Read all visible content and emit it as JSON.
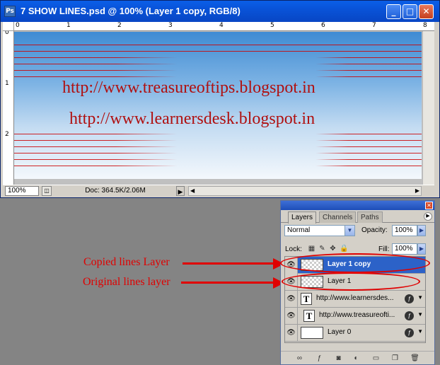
{
  "window": {
    "title": "7 SHOW LINES.psd @ 100% (Layer 1 copy, RGB/8)",
    "app_icon": "Ps",
    "minimize_glyph": "_",
    "maximize_glyph": "□",
    "close_glyph": "✕"
  },
  "rulers": {
    "horizontal": [
      "0",
      "1",
      "2",
      "3",
      "4",
      "5",
      "6",
      "7",
      "8"
    ],
    "vertical": [
      "0",
      "1",
      "2"
    ]
  },
  "canvas": {
    "url_1": "http://www.treasureoftips.blogspot.in",
    "url_2": "http://www.learnersdesk.blogspot.in"
  },
  "status": {
    "zoom": "100%",
    "doc_info": "Doc: 364.5K/2.06M",
    "arrow_glyph": "▶",
    "scroll_left": "◀",
    "scroll_right": "▶"
  },
  "layers_panel": {
    "tabs": [
      "Layers",
      "Channels",
      "Paths"
    ],
    "blend_mode": "Normal",
    "opacity_label": "Opacity:",
    "opacity_value": "100%",
    "lock_label": "Lock:",
    "fill_label": "Fill:",
    "fill_value": "100%",
    "layers": [
      {
        "name": "Layer 1 copy",
        "selected": true,
        "thumb": "transparent"
      },
      {
        "name": "Layer 1",
        "selected": false,
        "thumb": "transparent"
      },
      {
        "name": "http://www.learnersdes...",
        "selected": false,
        "thumb": "text",
        "glyph": "T"
      },
      {
        "name": "http://www.treasureofti...",
        "selected": false,
        "thumb": "text",
        "glyph": "T"
      },
      {
        "name": "Layer 0",
        "selected": false,
        "thumb": "white"
      }
    ]
  },
  "annotations": {
    "copied": "Copied lines Layer",
    "original": "Original lines layer"
  },
  "colors": {
    "annotation": "#e00000",
    "selection": "#2c62c8",
    "titlebar": "#0953d8"
  },
  "icons": [
    "eye-icon",
    "text-layer-icon",
    "fx-icon",
    "lock-icon",
    "link-icon",
    "trash-icon"
  ]
}
